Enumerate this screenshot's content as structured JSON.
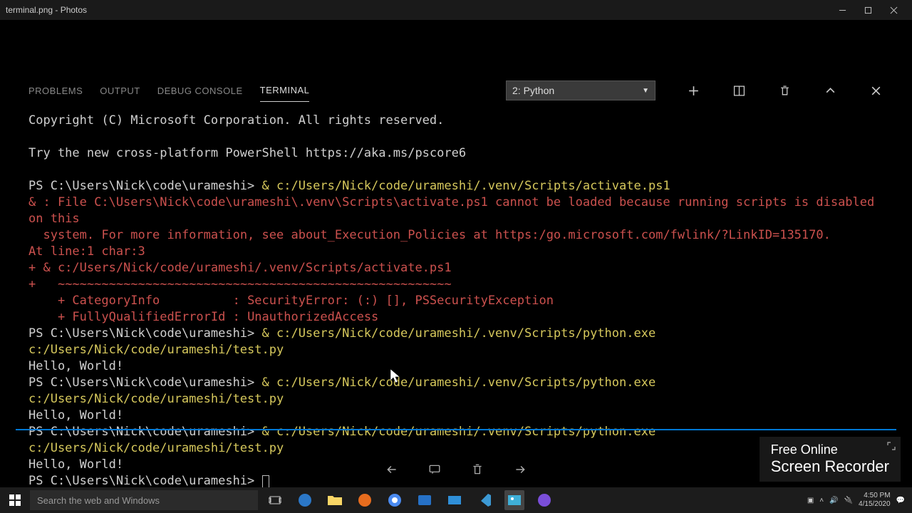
{
  "titlebar": {
    "title": "terminal.png - Photos"
  },
  "panel": {
    "tabs": {
      "problems": "PROBLEMS",
      "output": "OUTPUT",
      "debug": "DEBUG CONSOLE",
      "terminal": "TERMINAL"
    },
    "selector": "2: Python"
  },
  "term": {
    "copyright": "Copyright (C) Microsoft Corporation. All rights reserved.",
    "tryps": "Try the new cross-platform PowerShell https://aka.ms/pscore6",
    "prompt1": "PS C:\\Users\\Nick\\code\\urameshi> ",
    "cmd1": "& c:/Users/Nick/code/urameshi/.venv/Scripts/activate.ps1",
    "err1": "& : File C:\\Users\\Nick\\code\\urameshi\\.venv\\Scripts\\activate.ps1 cannot be loaded because running scripts is disabled on this",
    "err2": "  system. For more information, see about_Execution_Policies at https:/go.microsoft.com/fwlink/?LinkID=135170.",
    "err3": "At line:1 char:3",
    "err4": "+ & c:/Users/Nick/code/urameshi/.venv/Scripts/activate.ps1",
    "err5_plus": "+",
    "err5_tilde": "   ~~~~~~~~~~~~~~~~~~~~~~~~~~~~~~~~~~~~~~~~~~~~~~~~~~~~~~",
    "err6a": "    + CategoryInfo          : ",
    "err6b": "SecurityError: (:) [], PSSecurityException",
    "err7a": "    + FullyQualifiedErrorId : ",
    "err7b": "UnauthorizedAccess",
    "prompt2": "PS C:\\Users\\Nick\\code\\urameshi> ",
    "cmd2": "& c:/Users/Nick/code/urameshi/.venv/Scripts/python.exe c:/Users/Nick/code/urameshi/test.py",
    "out2": "Hello, World!",
    "prompt3": "PS C:\\Users\\Nick\\code\\urameshi> ",
    "cmd3": "& c:/Users/Nick/code/urameshi/.venv/Scripts/python.exe c:/Users/Nick/code/urameshi/test.py",
    "out3": "Hello, World!",
    "prompt4": "PS C:\\Users\\Nick\\code\\urameshi> ",
    "cmd4": "& c:/Users/Nick/code/urameshi/.venv/Scripts/python.exe c:/Users/Nick/code/urameshi/test.py",
    "out4": "Hello, World!",
    "prompt5": "PS C:\\Users\\Nick\\code\\urameshi> "
  },
  "search": {
    "placeholder": "Search the web and Windows"
  },
  "recorder": {
    "line1": "Free Online",
    "line2": "Screen Recorder"
  },
  "systray": {
    "time": "4:50 PM",
    "date": "4/15/2020"
  }
}
